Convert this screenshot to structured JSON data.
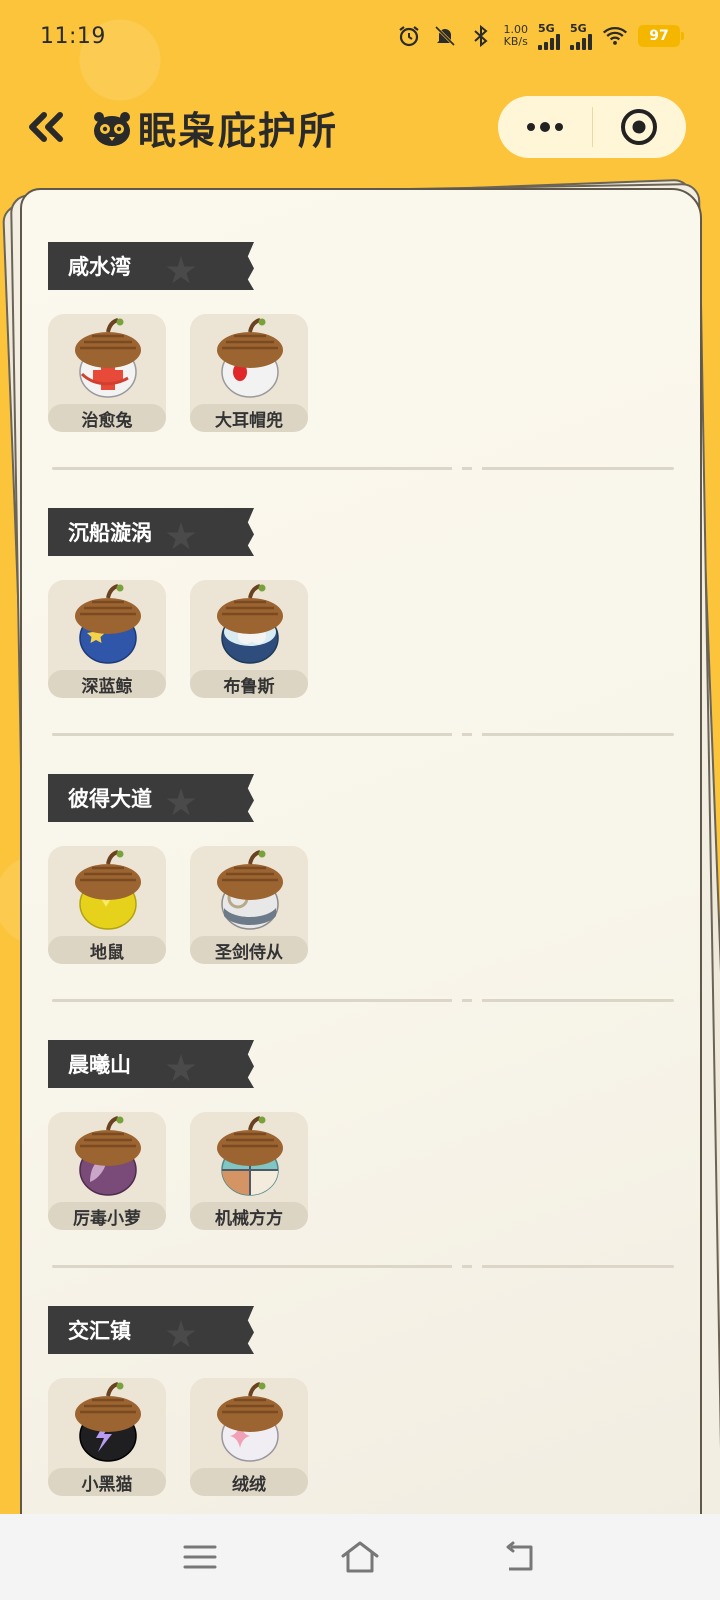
{
  "status_bar": {
    "time": "11:19",
    "net_speed_value": "1.00",
    "net_speed_unit": "KB/s",
    "signal_1": "5G",
    "signal_2": "5G",
    "battery": "97"
  },
  "header": {
    "title": "眠枭庇护所",
    "back_icon": "double-chevron-left-icon",
    "menu_icon": "more-dots-icon",
    "close_icon": "target-circle-icon"
  },
  "sections": [
    {
      "name": "咸水湾",
      "items": [
        {
          "label": "治愈兔",
          "icon": "acorn-red-cross-icon"
        },
        {
          "label": "大耳帽兜",
          "icon": "acorn-red-dot-icon"
        }
      ]
    },
    {
      "name": "沉船漩涡",
      "items": [
        {
          "label": "深蓝鲸",
          "icon": "acorn-blue-star-icon"
        },
        {
          "label": "布鲁斯",
          "icon": "acorn-blue-white-icon"
        }
      ]
    },
    {
      "name": "彼得大道",
      "items": [
        {
          "label": "地鼠",
          "icon": "acorn-yellow-icon"
        },
        {
          "label": "圣剑侍从",
          "icon": "acorn-grey-ring-icon"
        }
      ]
    },
    {
      "name": "晨曦山",
      "items": [
        {
          "label": "厉毒小萝",
          "icon": "acorn-purple-leaf-icon"
        },
        {
          "label": "机械方方",
          "icon": "acorn-checker-icon"
        }
      ]
    },
    {
      "name": "交汇镇",
      "items": [
        {
          "label": "小黑猫",
          "icon": "acorn-black-bolt-icon"
        },
        {
          "label": "绒绒",
          "icon": "acorn-pink-sparkle-icon"
        }
      ]
    }
  ],
  "nav": {
    "menu_icon": "menu-icon",
    "home_icon": "home-icon",
    "back_icon": "back-icon"
  }
}
